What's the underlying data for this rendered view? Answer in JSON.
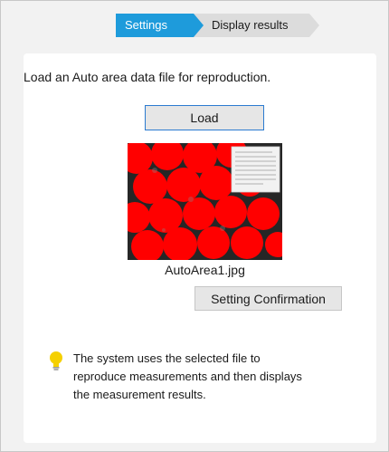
{
  "steps": [
    {
      "label": "Settings",
      "active": true
    },
    {
      "label": "Display results",
      "active": false
    }
  ],
  "colors": {
    "active_step": "#1e9bdb",
    "inactive_step": "#dcdcdc",
    "load_border": "#2b7bd0",
    "overlay_red": "#ff0000"
  },
  "panel": {
    "instruction": "Load an Auto area data file for reproduction.",
    "load_button": "Load",
    "file_name": "AutoArea1.jpg",
    "confirm_button": "Setting Confirmation",
    "info_icon": "lightbulb-icon",
    "info_text": "The system uses the selected file to reproduce measurements and then displays the measurement results."
  }
}
